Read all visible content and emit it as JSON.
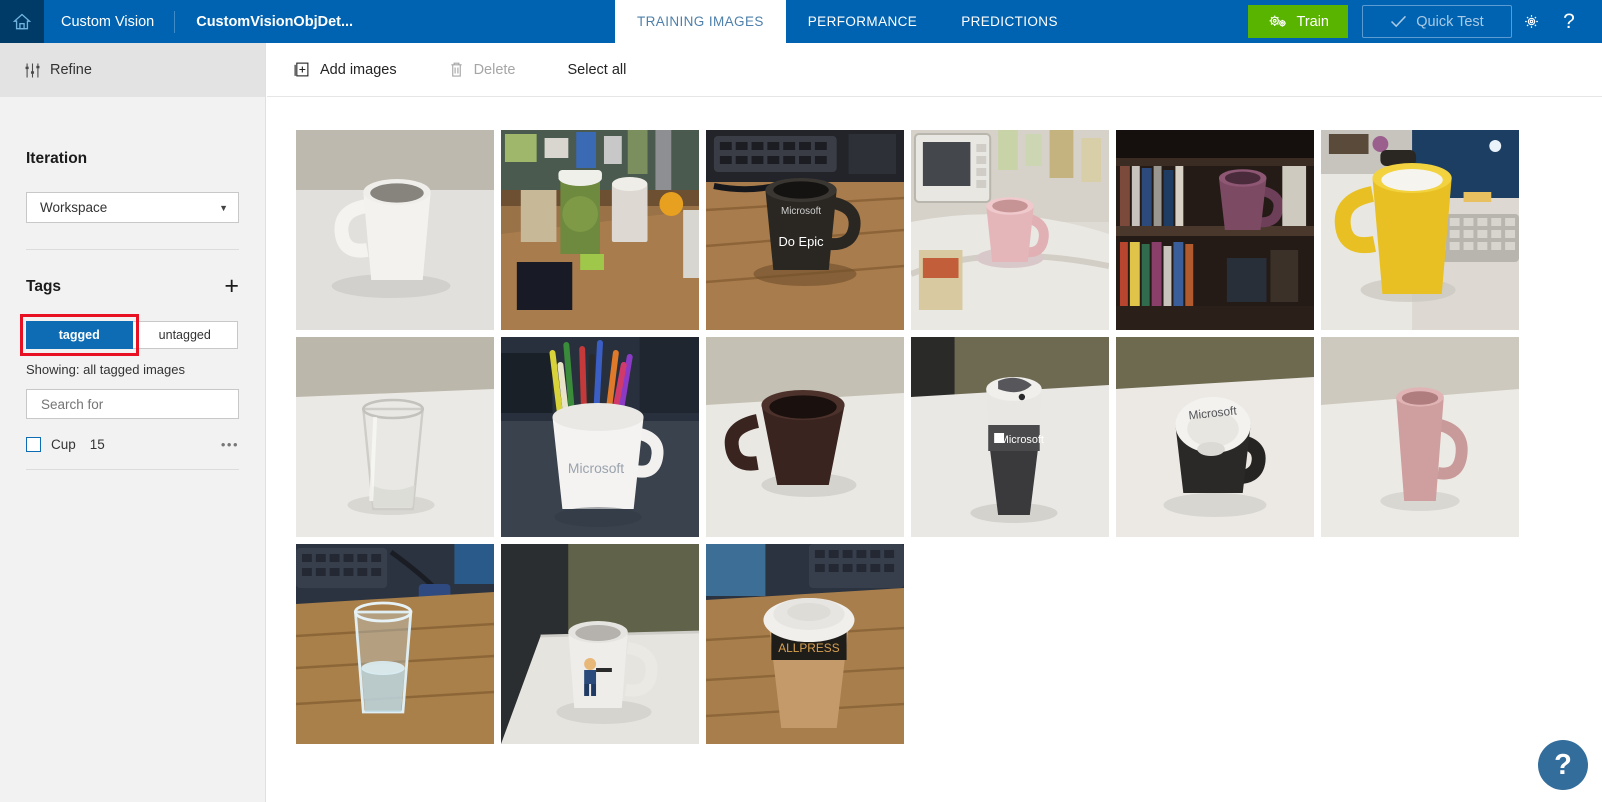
{
  "header": {
    "home_icon": "home-icon",
    "brand": "Custom Vision",
    "project_name": "CustomVisionObjDet...",
    "tabs": [
      {
        "label": "TRAINING IMAGES",
        "active": true
      },
      {
        "label": "PERFORMANCE",
        "active": false
      },
      {
        "label": "PREDICTIONS",
        "active": false
      }
    ],
    "train_label": "Train",
    "train_icon": "gears-icon",
    "quick_test_label": "Quick Test",
    "quick_test_icon": "checkmark-icon",
    "settings_icon": "gear-icon",
    "help_icon": "question-mark-icon",
    "colors": {
      "header_blue": "#0063B1",
      "home_navy": "#003A66",
      "train_green": "#59B400",
      "active_tab_text": "#4E80AB"
    }
  },
  "sidebar": {
    "refine_label": "Refine",
    "refine_icon": "sliders-icon",
    "iteration_heading": "Iteration",
    "iteration_value": "Workspace",
    "iteration_caret": "chevron-down-icon",
    "tags_heading": "Tags",
    "add_tag_icon": "plus-icon",
    "toggle": {
      "tagged_label": "tagged",
      "untagged_label": "untagged",
      "selected": "tagged",
      "highlight_color": "#E81123"
    },
    "showing_text": "Showing: all tagged images",
    "search_placeholder": "Search for",
    "search_value": "",
    "tags": [
      {
        "name": "Cup",
        "count": "15",
        "checked": false,
        "menu_icon": "ellipsis-icon"
      }
    ]
  },
  "toolbar": {
    "add_images_label": "Add images",
    "add_images_icon": "add-image-icon",
    "delete_label": "Delete",
    "delete_icon": "trash-icon",
    "delete_disabled": true,
    "select_all_label": "Select all"
  },
  "gallery": {
    "count": 15,
    "images": [
      {
        "alt": "white mug on white table",
        "bg": "#cfcdc8",
        "cup": "#efeeea",
        "table": "#dedcd8"
      },
      {
        "alt": "green takeaway cup and white mug on wooden desk",
        "bg": "#8a6a44",
        "cup": "#6e8a3e",
        "table": "#9a7247"
      },
      {
        "alt": "black Microsoft mug on wooden desk by keyboard",
        "bg": "#9c7242",
        "cup": "#2a2723",
        "table": "#a87a48"
      },
      {
        "alt": "pink mug on counter near microwave",
        "bg": "#cfc9c0",
        "cup": "#e0b0b4",
        "table": "#ddd8cf"
      },
      {
        "alt": "purple mug on bookshelf",
        "bg": "#2b211c",
        "cup": "#7d4a64",
        "table": "#3a2c24"
      },
      {
        "alt": "yellow mug beside keyboard and monitor",
        "bg": "#c9c6c2",
        "cup": "#e8c024",
        "table": "#e3e0db"
      },
      {
        "alt": "empty drinking glass on white table",
        "bg": "#d8d5cf",
        "cup": "#e7e6e3",
        "table": "#e3e1dc"
      },
      {
        "alt": "white Microsoft mug holding colored pencils",
        "bg": "#2c3340",
        "cup": "#f2f1ef",
        "table": "#39414f"
      },
      {
        "alt": "dark brown mug on white table",
        "bg": "#d6d3cd",
        "cup": "#3a2420",
        "table": "#e2e0db"
      },
      {
        "alt": "grey Microsoft travel tumbler on white table",
        "bg": "#cfcdc7",
        "cup": "#4a4a4c",
        "table": "#e0ded9"
      },
      {
        "alt": "black Microsoft cup tipped on white table",
        "bg": "#d5d2cc",
        "cup": "#2b2927",
        "table": "#e2e0db"
      },
      {
        "alt": "pink tall mug on white table",
        "bg": "#d2cfc9",
        "cup": "#c99a9a",
        "table": "#e1dfda"
      },
      {
        "alt": "glass of water on wooden desk with keyboard",
        "bg": "#96703f",
        "cup": "#cfe0e6",
        "table": "#a97f4a"
      },
      {
        "alt": "white mug with cartoon figure on white table",
        "bg": "#5e5f49",
        "cup": "#ebe9e4",
        "table": "#dfddd8"
      },
      {
        "alt": "takeaway coffee cup with lid on wooden desk",
        "bg": "#8d6b42",
        "cup": "#c69a6a",
        "table": "#a07a4b"
      }
    ]
  },
  "fab": {
    "help_label": "?",
    "color": "#336D9B"
  }
}
